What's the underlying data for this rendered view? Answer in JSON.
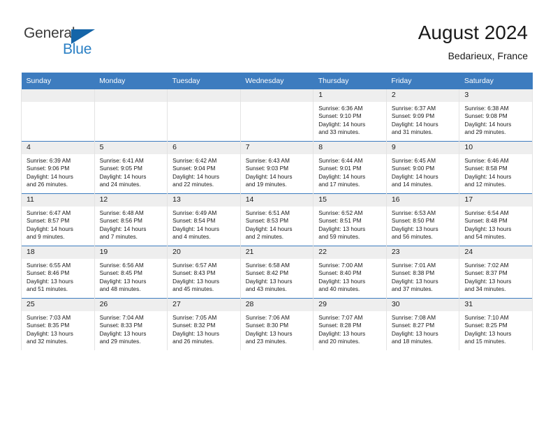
{
  "brand": {
    "name_part1": "General",
    "name_part2": "Blue",
    "accent_color": "#2a7fc4",
    "triangle_color": "#1565a8"
  },
  "header": {
    "title": "August 2024",
    "subtitle": "Bedarieux, France"
  },
  "theme": {
    "header_bar_color": "#3d7cbf",
    "daynum_band_color": "#eeeeee",
    "cell_border_color": "#e3e3e3"
  },
  "weekday_headers": [
    "Sunday",
    "Monday",
    "Tuesday",
    "Wednesday",
    "Thursday",
    "Friday",
    "Saturday"
  ],
  "weeks": [
    [
      {
        "day": "",
        "sunrise": "",
        "sunset": "",
        "daylight_line1": "",
        "daylight_line2": "",
        "empty": true
      },
      {
        "day": "",
        "sunrise": "",
        "sunset": "",
        "daylight_line1": "",
        "daylight_line2": "",
        "empty": true
      },
      {
        "day": "",
        "sunrise": "",
        "sunset": "",
        "daylight_line1": "",
        "daylight_line2": "",
        "empty": true
      },
      {
        "day": "",
        "sunrise": "",
        "sunset": "",
        "daylight_line1": "",
        "daylight_line2": "",
        "empty": true
      },
      {
        "day": "1",
        "sunrise": "Sunrise: 6:36 AM",
        "sunset": "Sunset: 9:10 PM",
        "daylight_line1": "Daylight: 14 hours",
        "daylight_line2": "and 33 minutes."
      },
      {
        "day": "2",
        "sunrise": "Sunrise: 6:37 AM",
        "sunset": "Sunset: 9:09 PM",
        "daylight_line1": "Daylight: 14 hours",
        "daylight_line2": "and 31 minutes."
      },
      {
        "day": "3",
        "sunrise": "Sunrise: 6:38 AM",
        "sunset": "Sunset: 9:08 PM",
        "daylight_line1": "Daylight: 14 hours",
        "daylight_line2": "and 29 minutes."
      }
    ],
    [
      {
        "day": "4",
        "sunrise": "Sunrise: 6:39 AM",
        "sunset": "Sunset: 9:06 PM",
        "daylight_line1": "Daylight: 14 hours",
        "daylight_line2": "and 26 minutes."
      },
      {
        "day": "5",
        "sunrise": "Sunrise: 6:41 AM",
        "sunset": "Sunset: 9:05 PM",
        "daylight_line1": "Daylight: 14 hours",
        "daylight_line2": "and 24 minutes."
      },
      {
        "day": "6",
        "sunrise": "Sunrise: 6:42 AM",
        "sunset": "Sunset: 9:04 PM",
        "daylight_line1": "Daylight: 14 hours",
        "daylight_line2": "and 22 minutes."
      },
      {
        "day": "7",
        "sunrise": "Sunrise: 6:43 AM",
        "sunset": "Sunset: 9:03 PM",
        "daylight_line1": "Daylight: 14 hours",
        "daylight_line2": "and 19 minutes."
      },
      {
        "day": "8",
        "sunrise": "Sunrise: 6:44 AM",
        "sunset": "Sunset: 9:01 PM",
        "daylight_line1": "Daylight: 14 hours",
        "daylight_line2": "and 17 minutes."
      },
      {
        "day": "9",
        "sunrise": "Sunrise: 6:45 AM",
        "sunset": "Sunset: 9:00 PM",
        "daylight_line1": "Daylight: 14 hours",
        "daylight_line2": "and 14 minutes."
      },
      {
        "day": "10",
        "sunrise": "Sunrise: 6:46 AM",
        "sunset": "Sunset: 8:58 PM",
        "daylight_line1": "Daylight: 14 hours",
        "daylight_line2": "and 12 minutes."
      }
    ],
    [
      {
        "day": "11",
        "sunrise": "Sunrise: 6:47 AM",
        "sunset": "Sunset: 8:57 PM",
        "daylight_line1": "Daylight: 14 hours",
        "daylight_line2": "and 9 minutes."
      },
      {
        "day": "12",
        "sunrise": "Sunrise: 6:48 AM",
        "sunset": "Sunset: 8:56 PM",
        "daylight_line1": "Daylight: 14 hours",
        "daylight_line2": "and 7 minutes."
      },
      {
        "day": "13",
        "sunrise": "Sunrise: 6:49 AM",
        "sunset": "Sunset: 8:54 PM",
        "daylight_line1": "Daylight: 14 hours",
        "daylight_line2": "and 4 minutes."
      },
      {
        "day": "14",
        "sunrise": "Sunrise: 6:51 AM",
        "sunset": "Sunset: 8:53 PM",
        "daylight_line1": "Daylight: 14 hours",
        "daylight_line2": "and 2 minutes."
      },
      {
        "day": "15",
        "sunrise": "Sunrise: 6:52 AM",
        "sunset": "Sunset: 8:51 PM",
        "daylight_line1": "Daylight: 13 hours",
        "daylight_line2": "and 59 minutes."
      },
      {
        "day": "16",
        "sunrise": "Sunrise: 6:53 AM",
        "sunset": "Sunset: 8:50 PM",
        "daylight_line1": "Daylight: 13 hours",
        "daylight_line2": "and 56 minutes."
      },
      {
        "day": "17",
        "sunrise": "Sunrise: 6:54 AM",
        "sunset": "Sunset: 8:48 PM",
        "daylight_line1": "Daylight: 13 hours",
        "daylight_line2": "and 54 minutes."
      }
    ],
    [
      {
        "day": "18",
        "sunrise": "Sunrise: 6:55 AM",
        "sunset": "Sunset: 8:46 PM",
        "daylight_line1": "Daylight: 13 hours",
        "daylight_line2": "and 51 minutes."
      },
      {
        "day": "19",
        "sunrise": "Sunrise: 6:56 AM",
        "sunset": "Sunset: 8:45 PM",
        "daylight_line1": "Daylight: 13 hours",
        "daylight_line2": "and 48 minutes."
      },
      {
        "day": "20",
        "sunrise": "Sunrise: 6:57 AM",
        "sunset": "Sunset: 8:43 PM",
        "daylight_line1": "Daylight: 13 hours",
        "daylight_line2": "and 45 minutes."
      },
      {
        "day": "21",
        "sunrise": "Sunrise: 6:58 AM",
        "sunset": "Sunset: 8:42 PM",
        "daylight_line1": "Daylight: 13 hours",
        "daylight_line2": "and 43 minutes."
      },
      {
        "day": "22",
        "sunrise": "Sunrise: 7:00 AM",
        "sunset": "Sunset: 8:40 PM",
        "daylight_line1": "Daylight: 13 hours",
        "daylight_line2": "and 40 minutes."
      },
      {
        "day": "23",
        "sunrise": "Sunrise: 7:01 AM",
        "sunset": "Sunset: 8:38 PM",
        "daylight_line1": "Daylight: 13 hours",
        "daylight_line2": "and 37 minutes."
      },
      {
        "day": "24",
        "sunrise": "Sunrise: 7:02 AM",
        "sunset": "Sunset: 8:37 PM",
        "daylight_line1": "Daylight: 13 hours",
        "daylight_line2": "and 34 minutes."
      }
    ],
    [
      {
        "day": "25",
        "sunrise": "Sunrise: 7:03 AM",
        "sunset": "Sunset: 8:35 PM",
        "daylight_line1": "Daylight: 13 hours",
        "daylight_line2": "and 32 minutes."
      },
      {
        "day": "26",
        "sunrise": "Sunrise: 7:04 AM",
        "sunset": "Sunset: 8:33 PM",
        "daylight_line1": "Daylight: 13 hours",
        "daylight_line2": "and 29 minutes."
      },
      {
        "day": "27",
        "sunrise": "Sunrise: 7:05 AM",
        "sunset": "Sunset: 8:32 PM",
        "daylight_line1": "Daylight: 13 hours",
        "daylight_line2": "and 26 minutes."
      },
      {
        "day": "28",
        "sunrise": "Sunrise: 7:06 AM",
        "sunset": "Sunset: 8:30 PM",
        "daylight_line1": "Daylight: 13 hours",
        "daylight_line2": "and 23 minutes."
      },
      {
        "day": "29",
        "sunrise": "Sunrise: 7:07 AM",
        "sunset": "Sunset: 8:28 PM",
        "daylight_line1": "Daylight: 13 hours",
        "daylight_line2": "and 20 minutes."
      },
      {
        "day": "30",
        "sunrise": "Sunrise: 7:08 AM",
        "sunset": "Sunset: 8:27 PM",
        "daylight_line1": "Daylight: 13 hours",
        "daylight_line2": "and 18 minutes."
      },
      {
        "day": "31",
        "sunrise": "Sunrise: 7:10 AM",
        "sunset": "Sunset: 8:25 PM",
        "daylight_line1": "Daylight: 13 hours",
        "daylight_line2": "and 15 minutes."
      }
    ]
  ]
}
